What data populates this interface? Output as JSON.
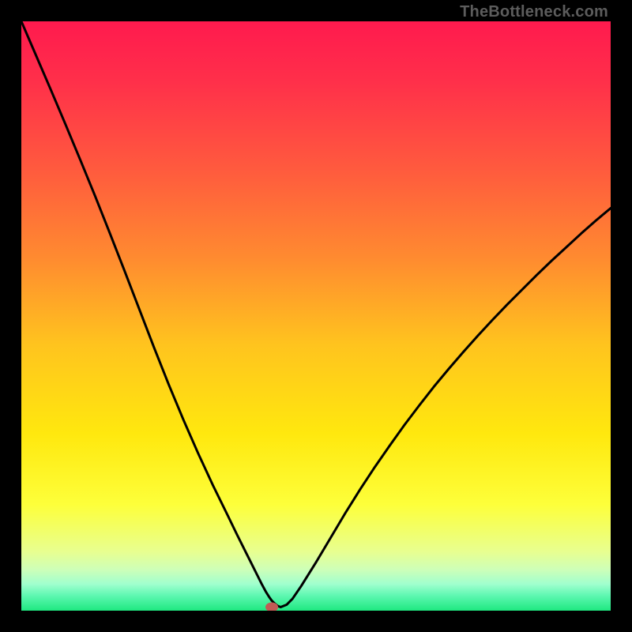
{
  "watermark": "TheBottleneck.com",
  "chart_data": {
    "type": "line",
    "title": "",
    "xlabel": "",
    "ylabel": "",
    "xlim": [
      0,
      100
    ],
    "ylim": [
      0,
      100
    ],
    "grid": false,
    "x": [
      0,
      2.5,
      5,
      7.5,
      10,
      12.5,
      15,
      17.5,
      20,
      22.5,
      25,
      27.5,
      30,
      32.5,
      35,
      36.5,
      38,
      39,
      40,
      40.8,
      41.5,
      42,
      42.5,
      43,
      43.5,
      44,
      45,
      46,
      47.5,
      50,
      52.5,
      55,
      57.5,
      60,
      62.5,
      65,
      67.5,
      70,
      72.5,
      75,
      77.5,
      80,
      82.5,
      85,
      87.5,
      90,
      92.5,
      95,
      97.5,
      100
    ],
    "y": [
      100,
      94.2,
      88.4,
      82.5,
      76.5,
      70.4,
      64.1,
      57.7,
      51.2,
      44.7,
      38.4,
      32.4,
      26.7,
      21.3,
      16.2,
      13.1,
      10.1,
      8.1,
      6.1,
      4.5,
      3.2,
      2.4,
      1.7,
      1.2,
      0.8,
      0.6,
      1.0,
      2.0,
      4.2,
      8.2,
      12.4,
      16.6,
      20.6,
      24.4,
      28.0,
      31.5,
      34.8,
      38.0,
      41.0,
      43.9,
      46.7,
      49.4,
      52.0,
      54.5,
      57.0,
      59.4,
      61.7,
      64.0,
      66.2,
      68.3
    ],
    "marker": {
      "x": 42.5,
      "y": 0.6
    },
    "gradient_stops": [
      {
        "offset": 0.0,
        "color": "#ff1a4e"
      },
      {
        "offset": 0.1,
        "color": "#ff2f4a"
      },
      {
        "offset": 0.25,
        "color": "#ff5a3e"
      },
      {
        "offset": 0.4,
        "color": "#ff8a30"
      },
      {
        "offset": 0.55,
        "color": "#ffc41e"
      },
      {
        "offset": 0.7,
        "color": "#ffe80e"
      },
      {
        "offset": 0.82,
        "color": "#fdff3a"
      },
      {
        "offset": 0.9,
        "color": "#e8ff90"
      },
      {
        "offset": 0.93,
        "color": "#ceffb8"
      },
      {
        "offset": 0.955,
        "color": "#a0ffce"
      },
      {
        "offset": 0.975,
        "color": "#5cf7b0"
      },
      {
        "offset": 1.0,
        "color": "#1fe880"
      }
    ]
  }
}
